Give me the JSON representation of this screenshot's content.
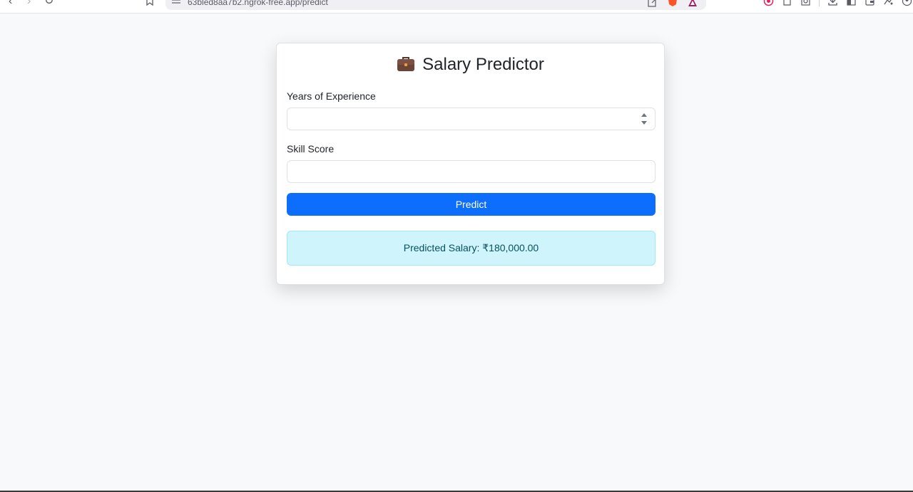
{
  "browser": {
    "url": "63bled8aa7b2.ngrok-free.app/predict"
  },
  "icons": {
    "back": "chevron-left-icon",
    "forward": "chevron-right-icon",
    "reload": "reload-icon",
    "bookmark": "bookmark-icon",
    "site_info": "site-info-icon",
    "title_icon": "briefcase-icon"
  },
  "form": {
    "title": "Salary Predictor",
    "experience_label": "Years of Experience",
    "experience_value": "",
    "skill_label": "Skill Score",
    "skill_value": "",
    "predict_label": "Predict"
  },
  "result": {
    "text": "Predicted Salary: ₹180,000.00"
  },
  "colors": {
    "primary": "#0d6efd",
    "info_bg": "#cff4fc",
    "info_text": "#055160",
    "page_bg": "#f8f9fa"
  }
}
